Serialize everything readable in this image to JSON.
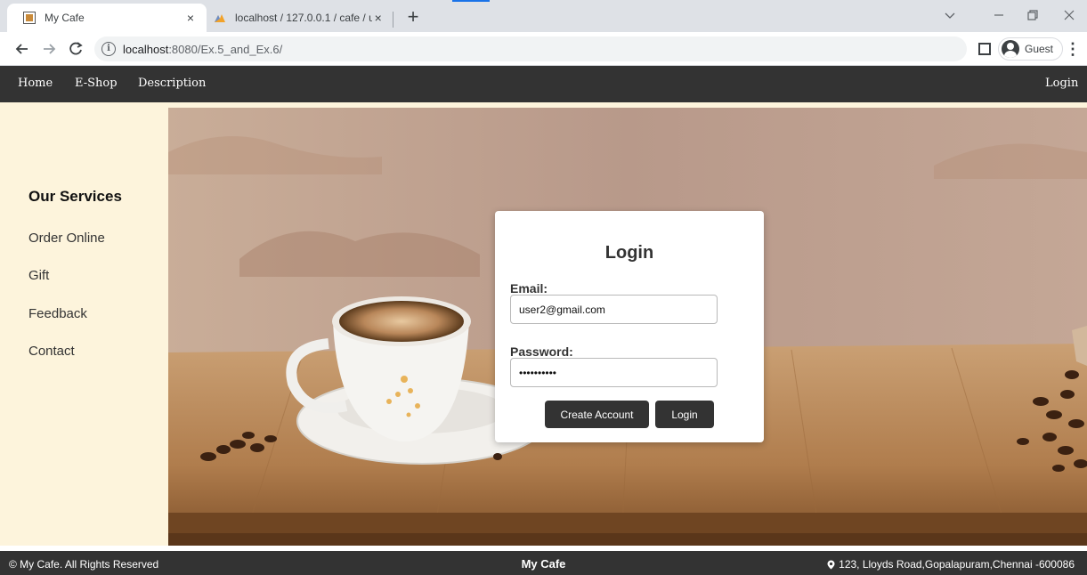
{
  "browser": {
    "tabs": [
      {
        "title": "My Cafe",
        "active": true
      },
      {
        "title": "localhost / 127.0.0.1 / cafe / use",
        "active": false
      }
    ],
    "url_host": "localhost",
    "url_path": ":8080/Ex.5_and_Ex.6/",
    "profile_label": "Guest",
    "new_tab_symbol": "+",
    "close_symbol": "×"
  },
  "nav": {
    "home": "Home",
    "eshop": "E-Shop",
    "description": "Description",
    "login": "Login"
  },
  "sidebar": {
    "title": "Our Services",
    "items": [
      {
        "label": "Order Online"
      },
      {
        "label": "Gift"
      },
      {
        "label": "Feedback"
      },
      {
        "label": "Contact"
      }
    ]
  },
  "login_form": {
    "title": "Login",
    "email_label": "Email:",
    "email_value": "user2@gmail.com",
    "password_label": "Password:",
    "password_value": "••••••••••",
    "create_account_label": "Create Account",
    "login_label": "Login"
  },
  "footer": {
    "copyright": "© My Cafe. All Rights Reserved",
    "brand": "My Cafe",
    "address": "123, Lloyds Road,Gopalapuram,Chennai -600086"
  },
  "colors": {
    "nav_bg": "#333333",
    "sidebar_bg": "#fdf4dc",
    "button_bg": "#333333"
  }
}
